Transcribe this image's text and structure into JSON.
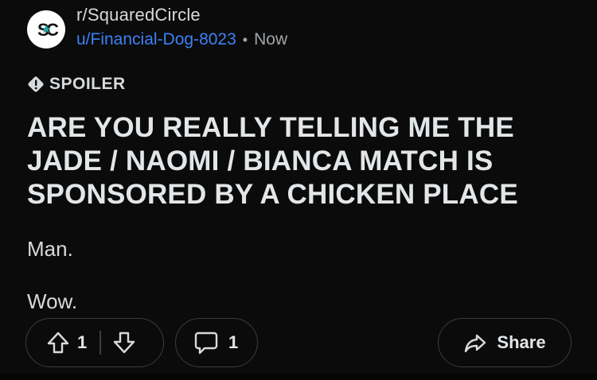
{
  "post": {
    "subreddit": "r/SquaredCircle",
    "author": "u/Financial-Dog-8023",
    "separator": "•",
    "timestamp": "Now",
    "avatar_icon": "squaredcircle-logo-icon",
    "spoiler": {
      "label": "SPOILER",
      "icon": "warning-diamond-icon"
    },
    "title": "ARE YOU REALLY TELLING ME THE JADE / NAOMI / BIANCA MATCH IS SPONSORED BY A CHICKEN PLACE",
    "body": [
      "Man.",
      "Wow."
    ]
  },
  "actions": {
    "upvote_icon": "arrow-up-icon",
    "vote_count": "1",
    "downvote_icon": "arrow-down-icon",
    "comment_icon": "comment-bubble-icon",
    "comment_count": "1",
    "share_icon": "share-arrow-icon",
    "share_label": "Share"
  },
  "colors": {
    "background": "#0b0b0b",
    "username_blue": "#3b82f6",
    "text": "#d7dadc",
    "muted": "#a0a5aa",
    "pill_border": "#3a3d40"
  }
}
